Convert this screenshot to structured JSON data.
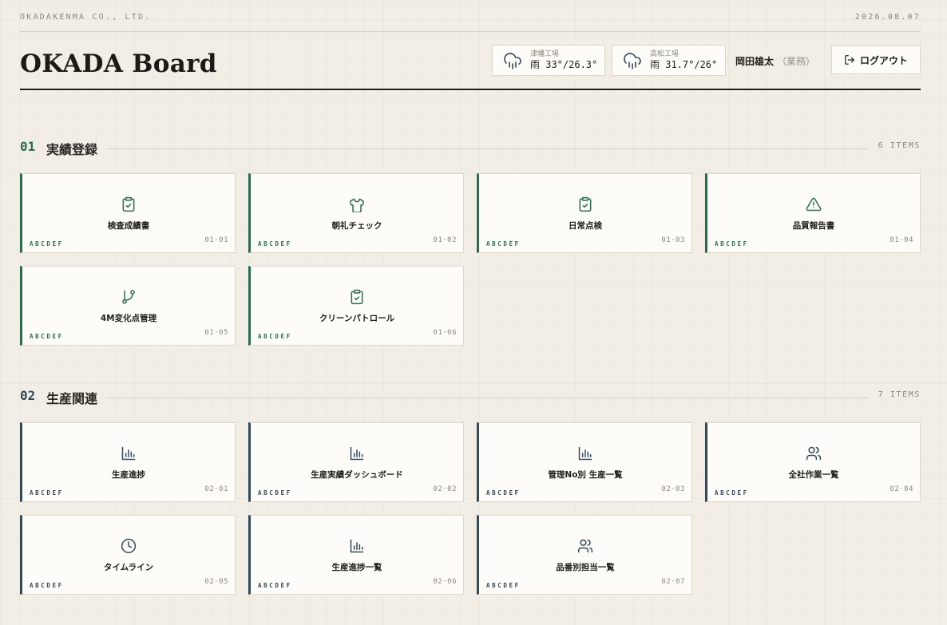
{
  "company": "OKADAKENMA CO., LTD.",
  "date": "2026.08.07",
  "app_title": "OKADA Board",
  "weather": [
    {
      "factory": "津幡工場",
      "value": "雨 33°/26.3°",
      "icon": "cloud-rain-icon"
    },
    {
      "factory": "高松工場",
      "value": "雨 31.7°/26°",
      "icon": "cloud-rain-icon"
    }
  ],
  "user": {
    "name": "岡田雄太",
    "role": "（業務）"
  },
  "logout_label": "ログアウト",
  "colors": {
    "green": "#2a6b4f",
    "slate": "#33485a",
    "background": "#f2eee5"
  },
  "sections": [
    {
      "number": "01",
      "title": "実績登録",
      "count": "6 ITEMS",
      "items": [
        {
          "label": "検査成績書",
          "code": "01·01",
          "tag": "ABCDEF",
          "icon": "clipboard-check-icon"
        },
        {
          "label": "朝礼チェック",
          "code": "01·02",
          "tag": "ABCDEF",
          "icon": "shirt-icon"
        },
        {
          "label": "日常点検",
          "code": "01·03",
          "tag": "ABCDEF",
          "icon": "clipboard-check-icon"
        },
        {
          "label": "品質報告書",
          "code": "01·04",
          "tag": "ABCDEF",
          "icon": "warning-triangle-icon"
        },
        {
          "label": "4M変化点管理",
          "code": "01·05",
          "tag": "ABCDEF",
          "icon": "git-branch-icon"
        },
        {
          "label": "クリーンパトロール",
          "code": "01·06",
          "tag": "ABCDEF",
          "icon": "clipboard-check-icon"
        }
      ]
    },
    {
      "number": "02",
      "title": "生産関連",
      "count": "7 ITEMS",
      "items": [
        {
          "label": "生産進捗",
          "code": "02·01",
          "tag": "ABCDEF",
          "icon": "bar-chart-icon"
        },
        {
          "label": "生産実績ダッシュボード",
          "code": "02·02",
          "tag": "ABCDEF",
          "icon": "bar-chart-icon"
        },
        {
          "label": "管理No別 生産一覧",
          "code": "02·03",
          "tag": "ABCDEF",
          "icon": "bar-chart-icon"
        },
        {
          "label": "全社作業一覧",
          "code": "02·04",
          "tag": "ABCDEF",
          "icon": "users-icon"
        },
        {
          "label": "タイムライン",
          "code": "02·05",
          "tag": "ABCDEF",
          "icon": "clock-icon"
        },
        {
          "label": "生産進捗一覧",
          "code": "02·06",
          "tag": "ABCDEF",
          "icon": "bar-chart-icon"
        },
        {
          "label": "品番別担当一覧",
          "code": "02·07",
          "tag": "ABCDEF",
          "icon": "users-icon"
        }
      ]
    }
  ]
}
